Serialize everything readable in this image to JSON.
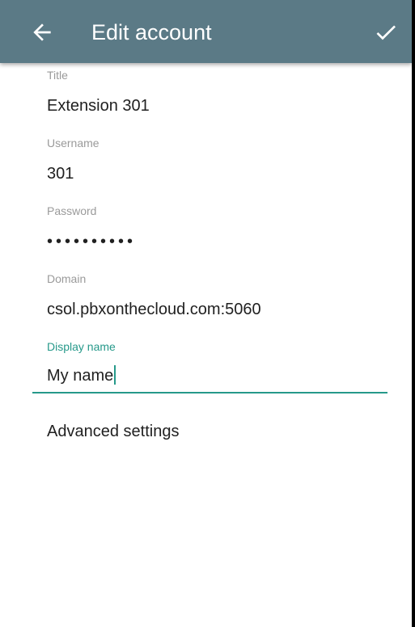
{
  "appbar": {
    "title": "Edit account",
    "back_icon": "arrow-back-icon",
    "confirm_icon": "check-icon",
    "color": "#5b7a86"
  },
  "fields": {
    "title": {
      "label": "Title",
      "value": "Extension 301"
    },
    "username": {
      "label": "Username",
      "value": "301"
    },
    "password": {
      "label": "Password",
      "value": "••••••••••"
    },
    "domain": {
      "label": "Domain",
      "value": "csol.pbxonthecloud.com:5060"
    },
    "display_name": {
      "label": "Display name",
      "value": "My name"
    }
  },
  "advanced_settings": "Advanced settings",
  "accent_color": "#26998a"
}
